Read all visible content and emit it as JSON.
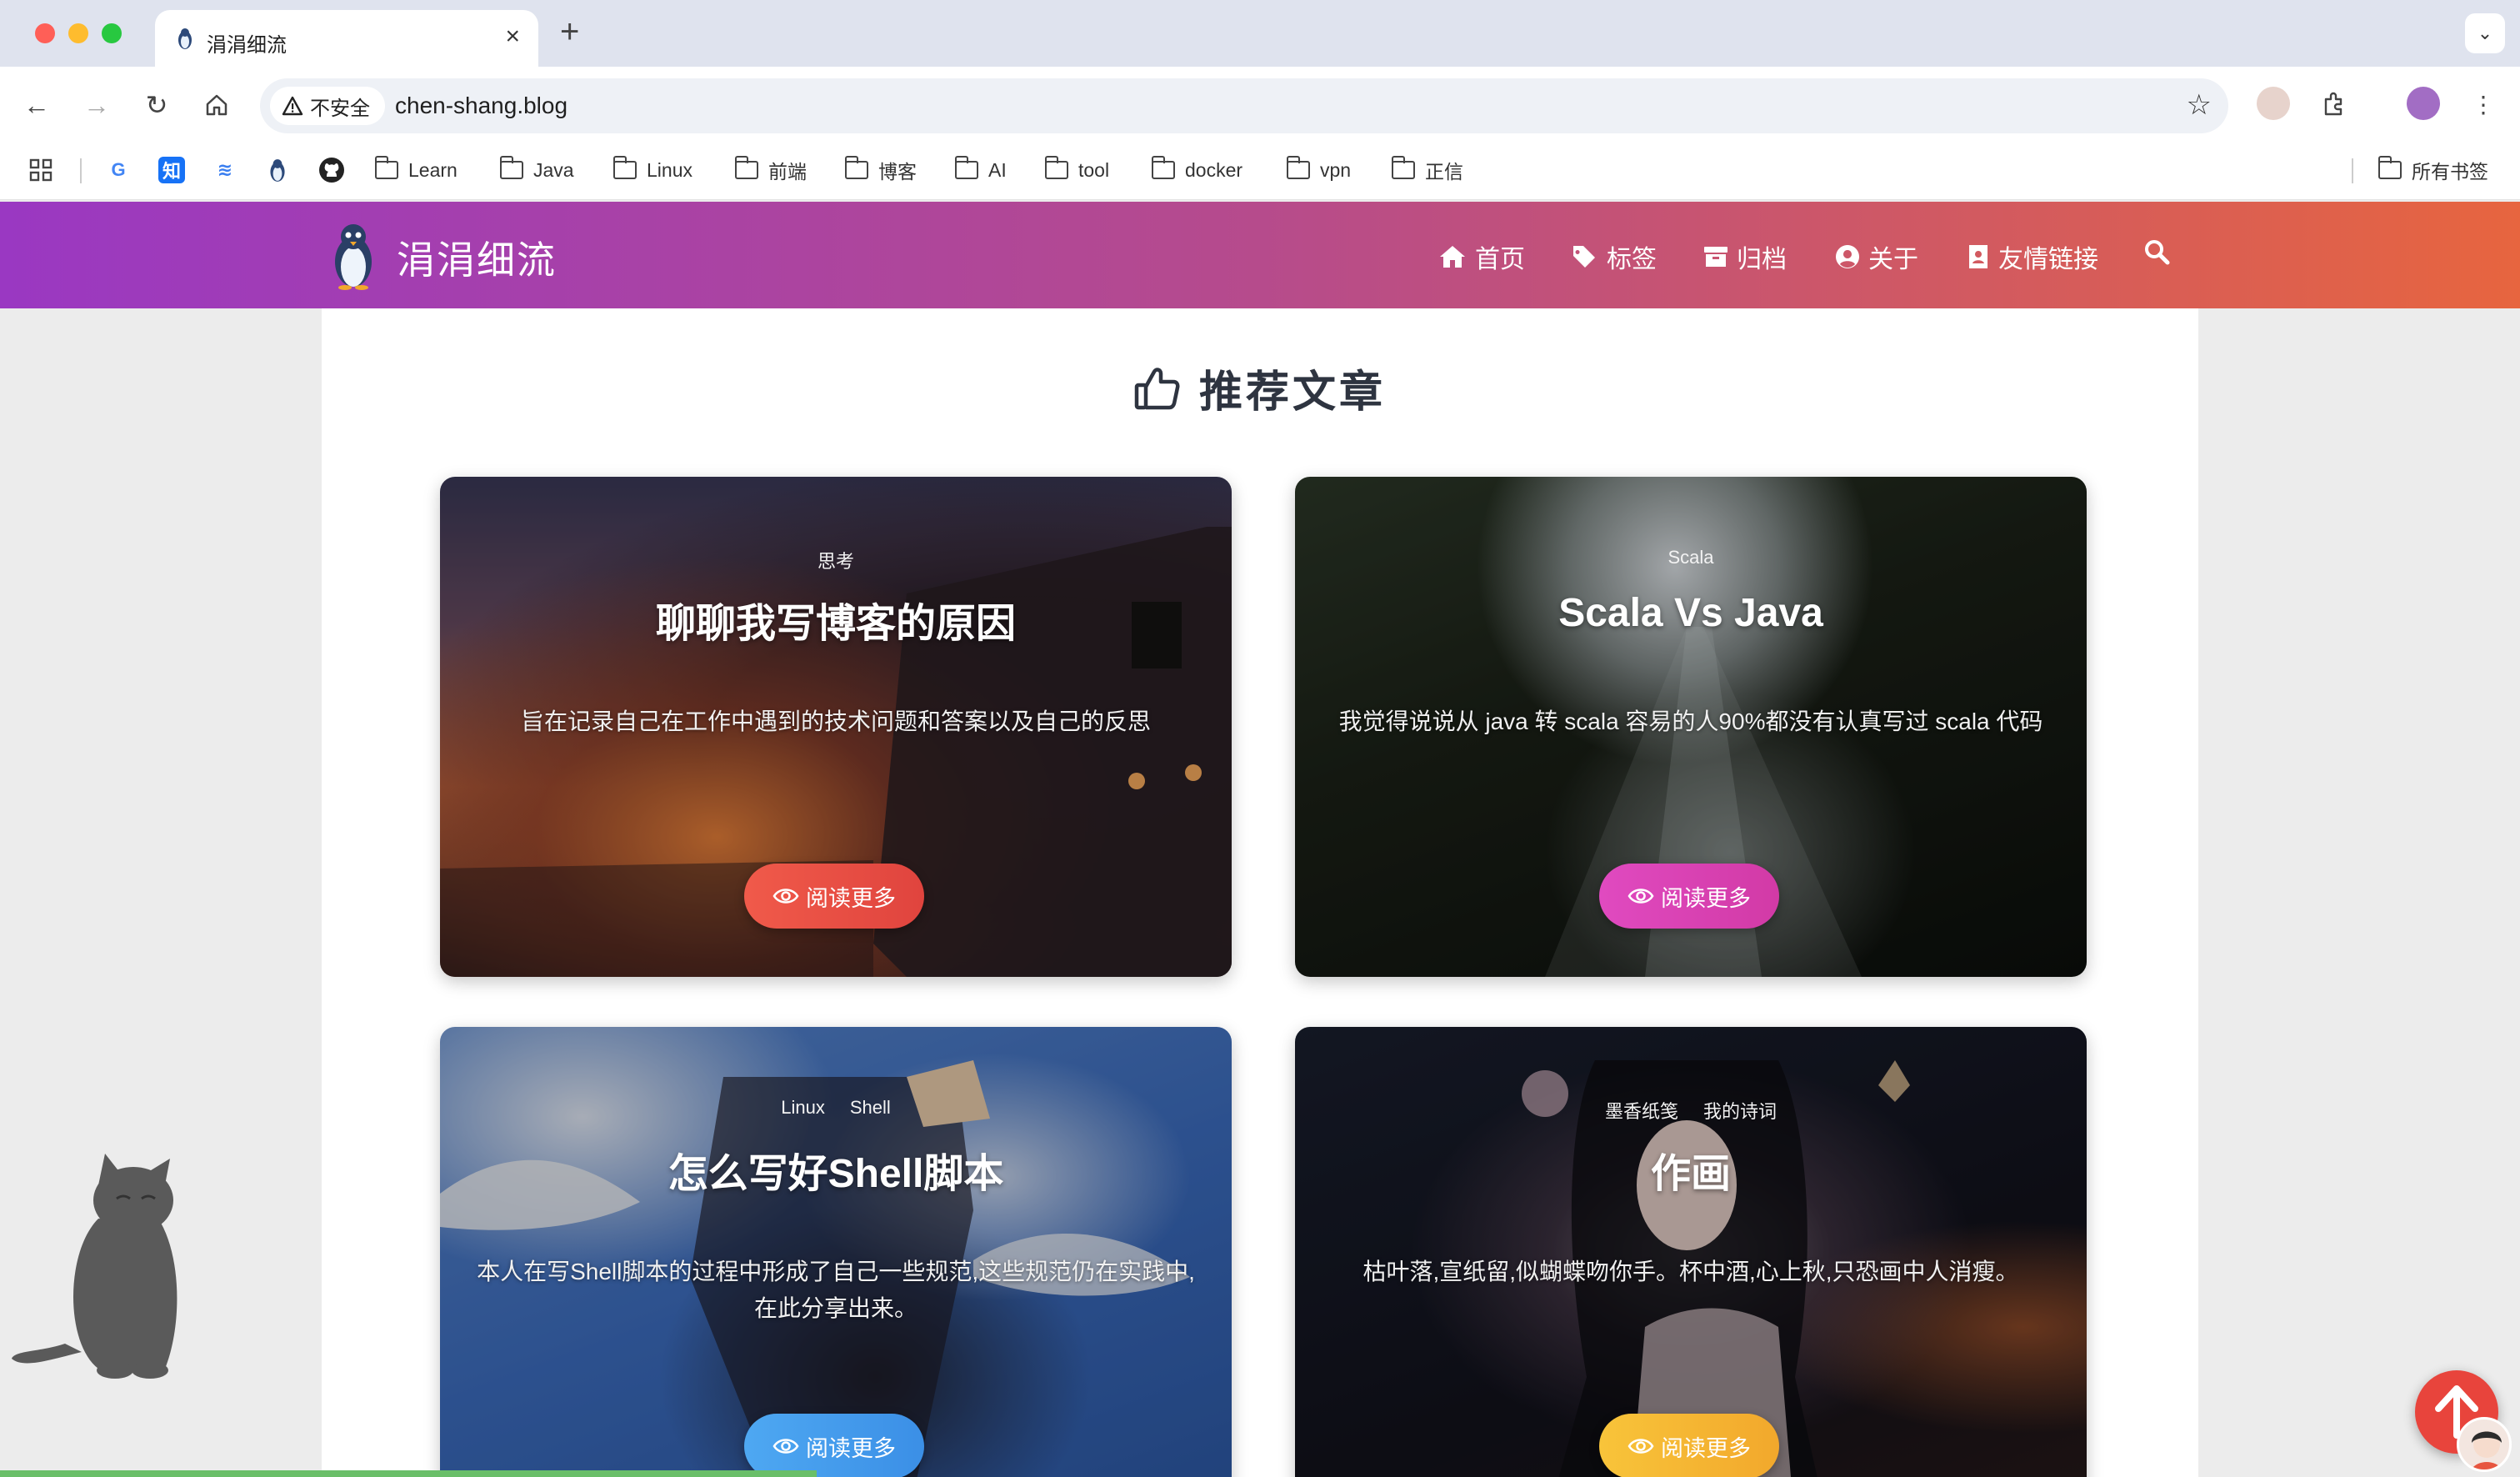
{
  "browser": {
    "tab_title": "涓涓细流",
    "new_tab_symbol": "+",
    "close_symbol": "×",
    "security_label": "不安全",
    "url": "chen-shang.blog",
    "bookmarks": [
      {
        "label": "Learn"
      },
      {
        "label": "Java"
      },
      {
        "label": "Linux"
      },
      {
        "label": "前端"
      },
      {
        "label": "博客"
      },
      {
        "label": "AI"
      },
      {
        "label": "tool"
      },
      {
        "label": "docker"
      },
      {
        "label": "vpn"
      },
      {
        "label": "正信"
      }
    ],
    "all_bookmarks_label": "所有书签"
  },
  "site": {
    "name": "涓涓细流",
    "nav": [
      {
        "label": "首页",
        "icon": "home-icon"
      },
      {
        "label": "标签",
        "icon": "tags-icon"
      },
      {
        "label": "归档",
        "icon": "archive-icon"
      },
      {
        "label": "关于",
        "icon": "user-circle-icon"
      },
      {
        "label": "友情链接",
        "icon": "address-book-icon"
      }
    ],
    "section_title": "推荐文章",
    "read_more_label": "阅读更多",
    "posts": [
      {
        "tags": [
          "思考"
        ],
        "title": "聊聊我写博客的原因",
        "description": "旨在记录自己在工作中遇到的技术问题和答案以及自己的反思",
        "button_color": "#e94a42"
      },
      {
        "tags": [
          "Scala"
        ],
        "title": "Scala Vs Java",
        "description": "我觉得说说从 java 转 scala 容易的人90%都没有认真写过 scala 代码",
        "button_color": "#d83fb0"
      },
      {
        "tags": [
          "Linux",
          "Shell"
        ],
        "title": "怎么写好Shell脚本",
        "description": "本人在写Shell脚本的过程中形成了自己一些规范,这些规范仍在实践中,在此分享出来。",
        "button_color": "#459be9"
      },
      {
        "tags": [
          "墨香纸笺",
          "我的诗词"
        ],
        "title": "作画",
        "description": "枯叶落,宣纸留,似蝴蝶吻你手。杯中酒,心上秋,只恐画中人消瘦。",
        "button_color": "#f4b430"
      }
    ]
  },
  "colors": {
    "header_gradient_start": "#9a38c2",
    "header_gradient_end": "#e7653f",
    "back_to_top": "#e8443c",
    "reading_progress": "#6abf69"
  }
}
